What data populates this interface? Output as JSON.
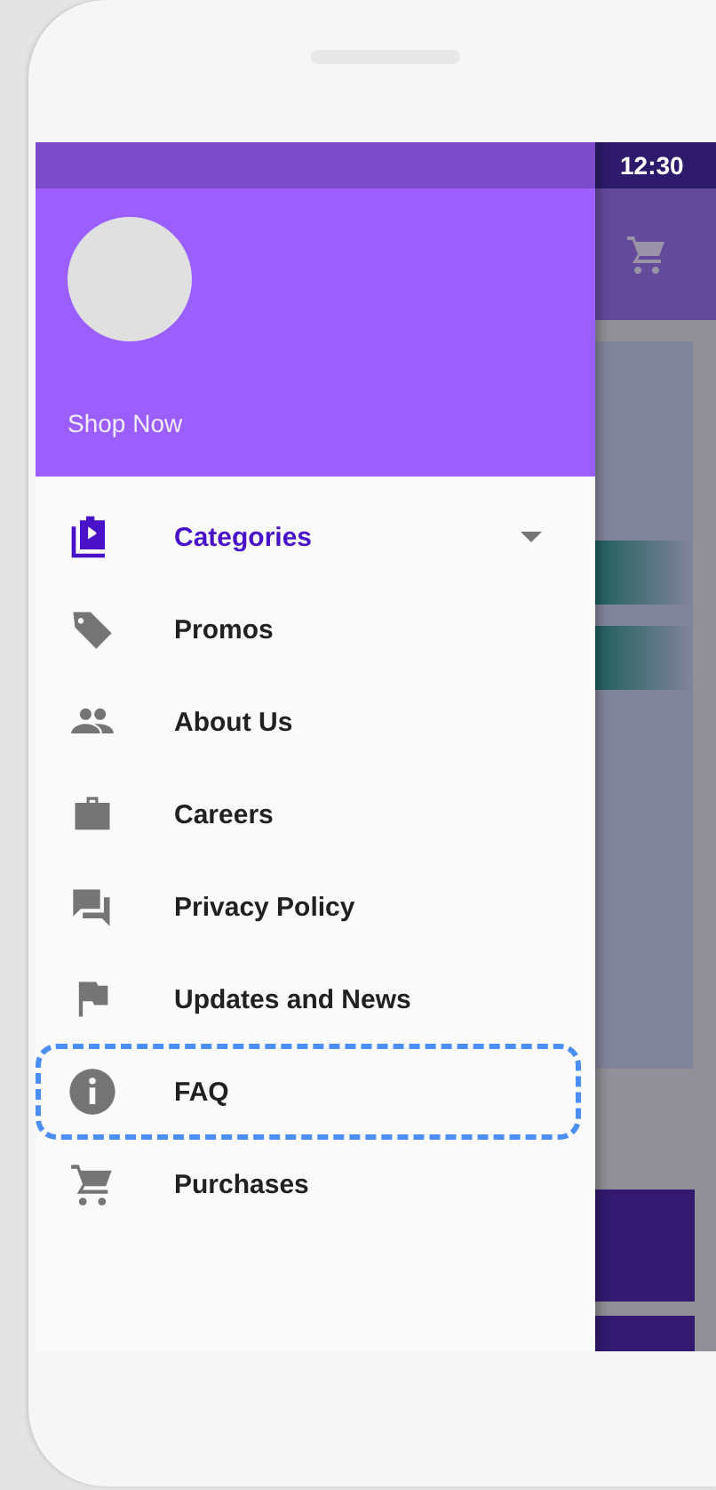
{
  "status_bar": {
    "time": "12:30"
  },
  "drawer": {
    "header": {
      "title": "Shop Now"
    },
    "items": [
      {
        "label": "Categories",
        "kind": "group",
        "expanded": false,
        "selected": true,
        "highlighted": false
      },
      {
        "label": "Promos",
        "kind": "link",
        "selected": false,
        "highlighted": false
      },
      {
        "label": "About Us",
        "kind": "link",
        "selected": false,
        "highlighted": false
      },
      {
        "label": "Careers",
        "kind": "link",
        "selected": false,
        "highlighted": false
      },
      {
        "label": "Privacy Policy",
        "kind": "link",
        "selected": false,
        "highlighted": false
      },
      {
        "label": "Updates and News",
        "kind": "link",
        "selected": false,
        "highlighted": false
      },
      {
        "label": "FAQ",
        "kind": "link",
        "selected": false,
        "highlighted": true
      },
      {
        "label": "Purchases",
        "kind": "link",
        "selected": false,
        "highlighted": false
      }
    ]
  }
}
